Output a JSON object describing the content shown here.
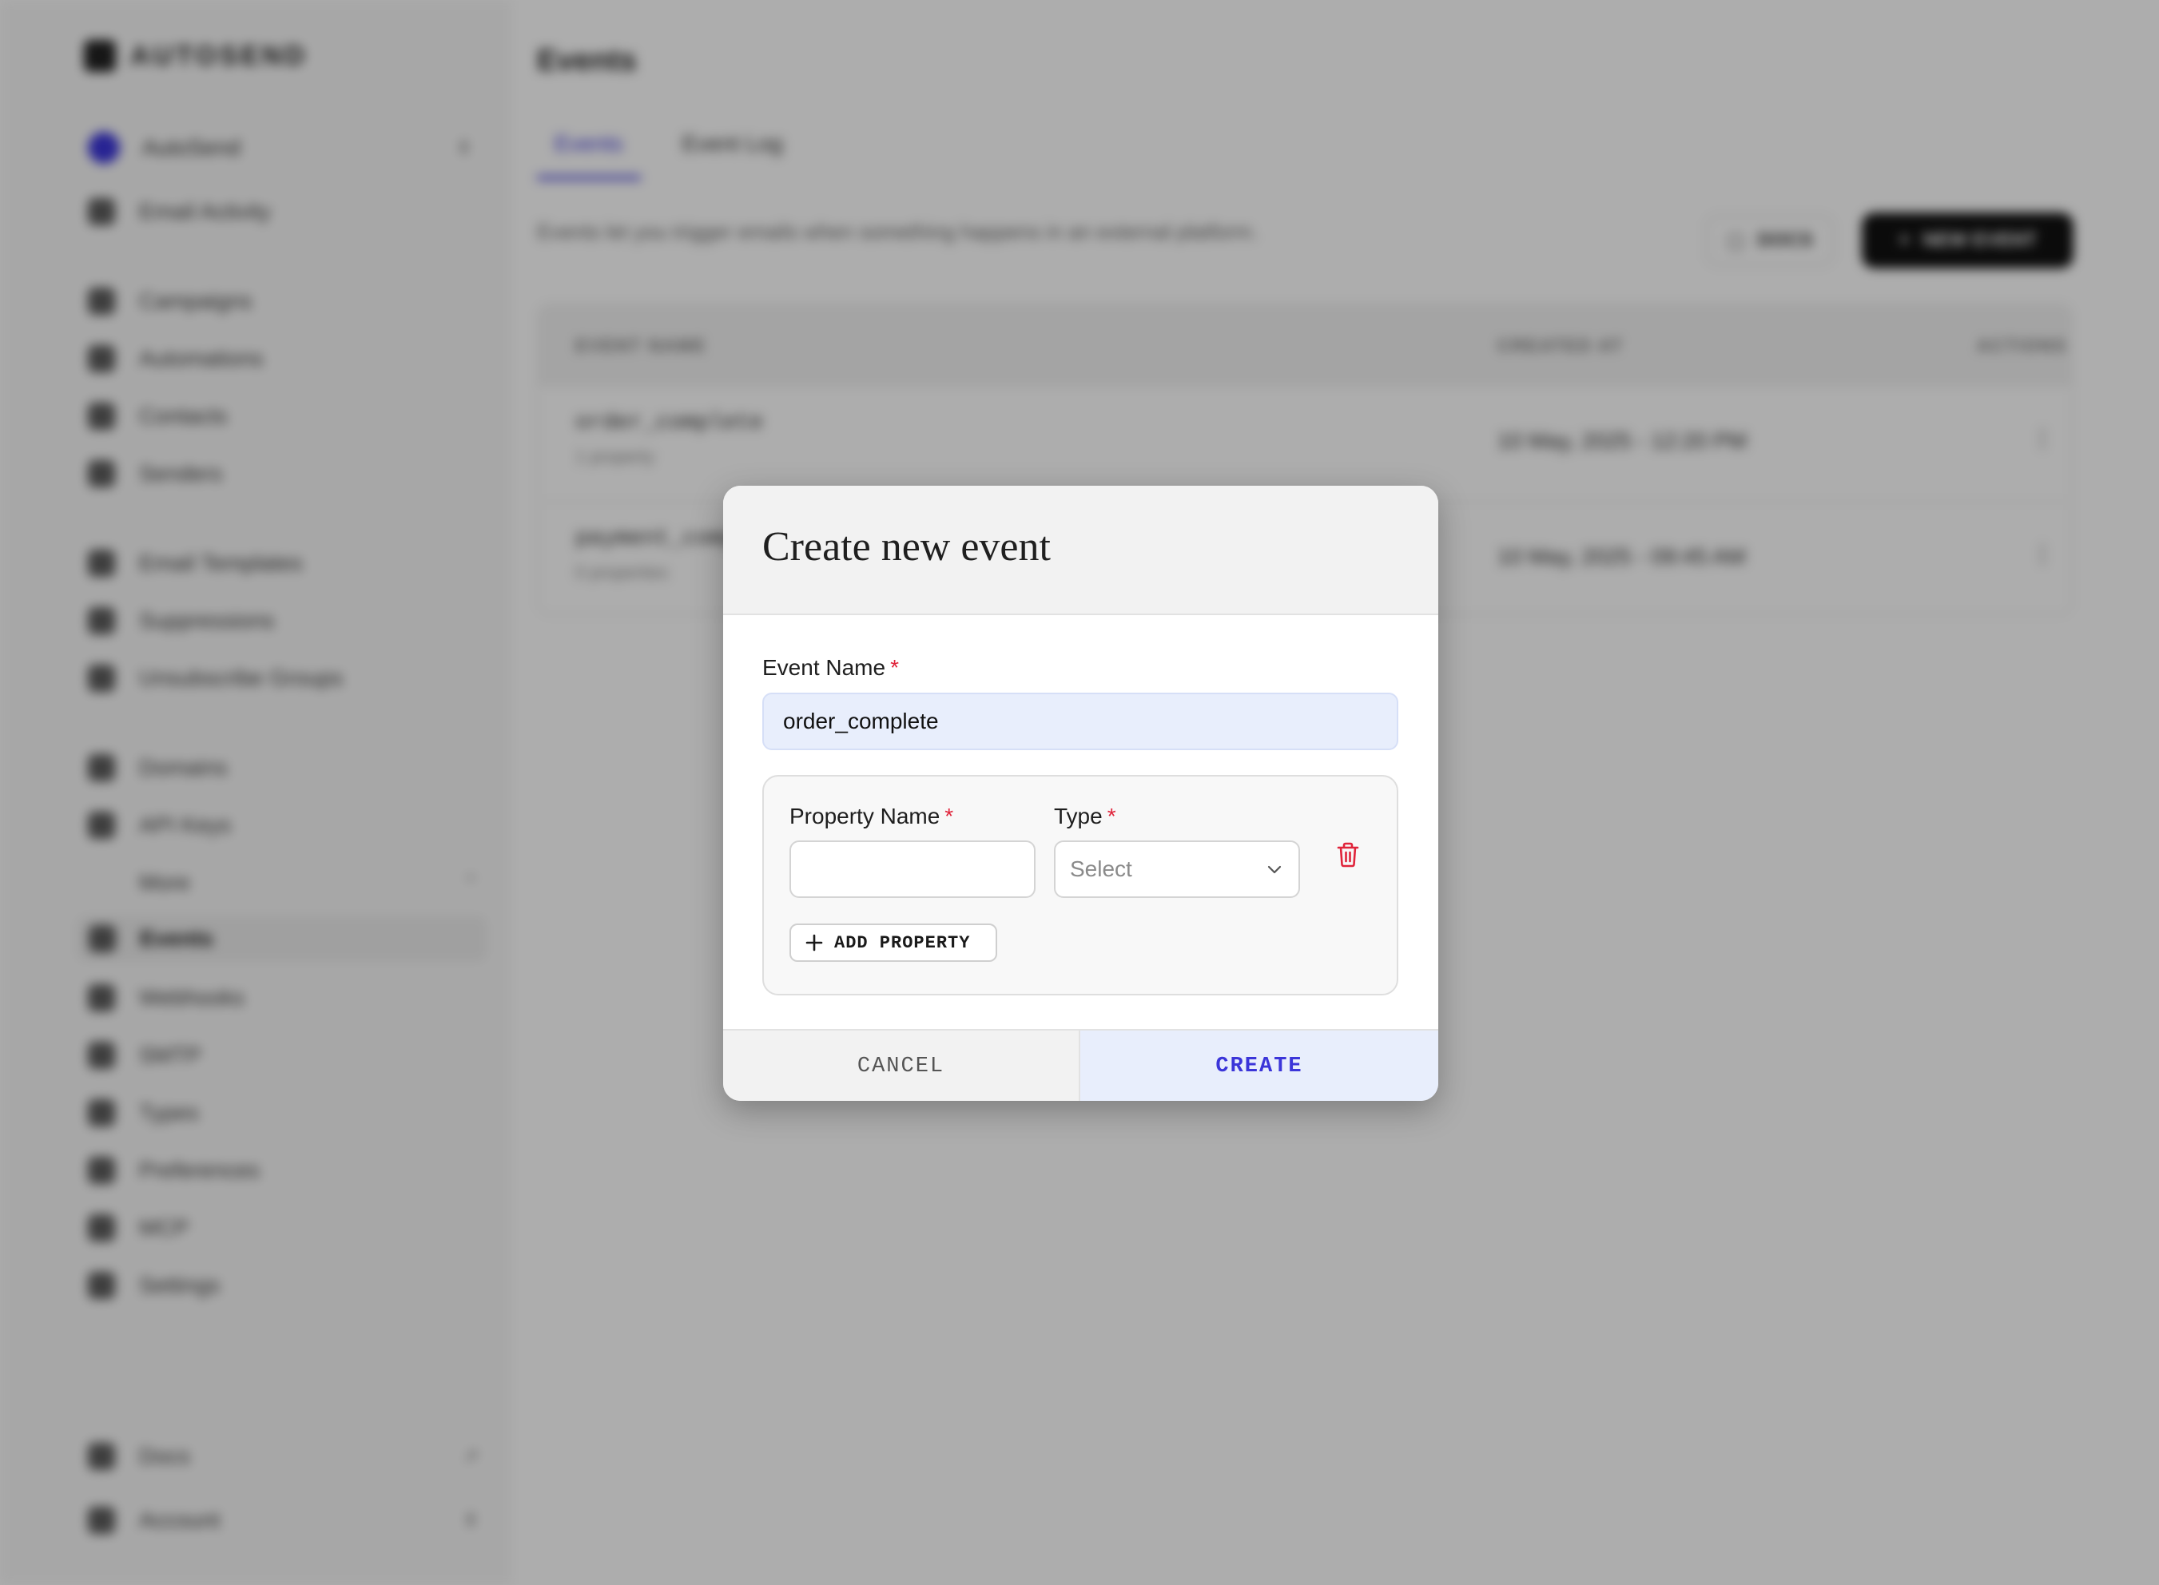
{
  "background": {
    "logo_text": "AUTOSEND",
    "org_name": "AutoSend",
    "sidebar_items": [
      {
        "label": "Email Activity"
      },
      {
        "label": "Campaigns"
      },
      {
        "label": "Automations"
      },
      {
        "label": "Contacts"
      },
      {
        "label": "Senders"
      },
      {
        "label": "Email Templates"
      },
      {
        "label": "Suppressions"
      },
      {
        "label": "Unsubscribe Groups"
      },
      {
        "label": "Domains"
      },
      {
        "label": "API Keys"
      },
      {
        "label": "More"
      },
      {
        "label": "Events"
      },
      {
        "label": "Webhooks"
      },
      {
        "label": "SMTP"
      },
      {
        "label": "Types"
      },
      {
        "label": "Preferences"
      },
      {
        "label": "MCP"
      },
      {
        "label": "Settings"
      }
    ],
    "sidebar_bottom": [
      {
        "label": "Docs"
      },
      {
        "label": "Account"
      }
    ],
    "page_title": "Events",
    "tabs": [
      {
        "label": "Events",
        "active": true
      },
      {
        "label": "Event Log",
        "active": false
      }
    ],
    "description": "Events let you trigger emails when something happens in an external platform.",
    "docs_button": "DOCS",
    "new_event_button": "NEW EVENT",
    "table": {
      "headers": [
        "EVENT NAME",
        "CREATED AT",
        "ACTIONS"
      ],
      "rows": [
        {
          "name": "order_complete",
          "sub": "1 property",
          "created": "10 May, 2025 - 12:20 PM"
        },
        {
          "name": "payment_complete",
          "sub": "0 properties",
          "created": "10 May, 2025 - 09:45 AM"
        }
      ]
    }
  },
  "modal": {
    "title": "Create new event",
    "event_name_label": "Event Name",
    "required_mark": "*",
    "event_name_value": "order_complete",
    "property_name_label": "Property Name",
    "type_label": "Type",
    "type_placeholder": "Select",
    "add_property_label": "ADD PROPERTY",
    "cancel_label": "CANCEL",
    "create_label": "CREATE"
  },
  "colors": {
    "accent": "#3b35d9",
    "danger": "#e0243b",
    "overlay": "rgba(0,0,0,0.32)"
  },
  "icons": {
    "trash": "trash-icon",
    "plus": "plus-icon",
    "chevron": "chevron-down-icon"
  }
}
